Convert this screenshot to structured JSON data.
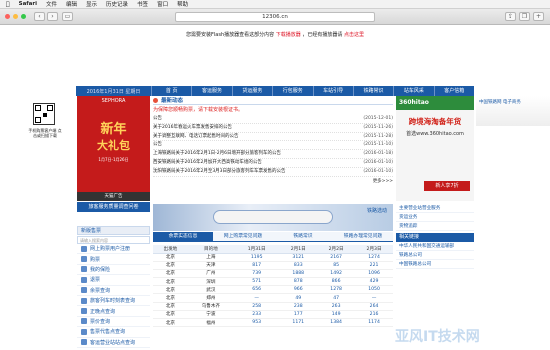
{
  "menubar": {
    "apple": "",
    "app": "Safari",
    "items": [
      "文件",
      "编辑",
      "显示",
      "历史记录",
      "书签",
      "窗口",
      "帮助"
    ]
  },
  "toolbar": {
    "url": "12306.cn",
    "back": "‹",
    "forward": "›"
  },
  "flash": {
    "text": "您需要安装Flash播放器查看这部分内容",
    "link": "下载播放器",
    "tail": "，已经有播放器请",
    "link2": "点击这里"
  },
  "nav": {
    "date": "2016年1月31日 星期日",
    "tabs": [
      "首 页",
      "客运服务",
      "货运服务",
      "行包服务",
      "车站引导",
      "铁路常识",
      "站车风采",
      "客户信箱"
    ]
  },
  "ad_left": {
    "qr_caption": "手机购票客户端 点击或扫描下载"
  },
  "sephora": {
    "brand": "SEPHORA",
    "line1": "新年",
    "line2": "大礼包",
    "line3": "1月7日-1月26日",
    "footer": "天猫广告"
  },
  "news": {
    "title": "最新动态",
    "notice": "为保障您顺畅购票，请下载安装根证书。",
    "notice_link": "根证书",
    "items": [
      {
        "t": "公告",
        "d": "(2015-12-01)"
      },
      {
        "t": "关于2016年春运火车票发售安排的公告",
        "d": "(2015-11-26)"
      },
      {
        "t": "关于调整互联网、电话订票起售时间的公告",
        "d": "(2015-11-28)"
      },
      {
        "t": "公告",
        "d": "(2015-11-10)"
      },
      {
        "t": "上海铁路局关于2016年2月1日-2月6日增开部分旅客列车的公告",
        "d": "(2016-01-18)"
      },
      {
        "t": "西安铁路局关于2016年2月加开大西高铁动车组的公告",
        "d": "(2016-01-10)"
      },
      {
        "t": "沈阳铁路局关于2016年2月至3月3日部分旅客列车车票发售的公告",
        "d": "(2016-01-10)"
      }
    ],
    "more": "更多>>>"
  },
  "hitao": {
    "brand": "360hitao",
    "line1": "跨境海淘备年货",
    "line2": "首选www.360hitao.com",
    "btn": "新人享7折"
  },
  "far_right": {
    "caption": "中国铁路网 电子商务"
  },
  "promo": {
    "label": "旅客服务质量调查问卷",
    "sub": "天猫广告"
  },
  "sidebar": {
    "header": "新版售票",
    "search_placeholder": "请输入搜索内容",
    "items": [
      "网上购票用户注册",
      "购票",
      "我的保险",
      "退票",
      "余票查询",
      "旅客列车时刻表查询",
      "正晚点查询",
      "票价查询",
      "售票代售点查询",
      "客运营业站站点查询"
    ]
  },
  "banner": {
    "label": "铁路选动",
    "sub": "中国铁路网络"
  },
  "table": {
    "tabs": [
      "余票实态信息",
      "网上购票常见问题",
      "铁路常识",
      "铁路办理常见问题"
    ],
    "headers": [
      "出发地",
      "目的地",
      "1月31日",
      "2月1日",
      "2月2日",
      "2月3日"
    ],
    "rows": [
      [
        "北京",
        "上海",
        "1195",
        "3121",
        "2167",
        "1274"
      ],
      [
        "北京",
        "天津",
        "817",
        "833",
        "85",
        "221"
      ],
      [
        "北京",
        "广州",
        "739",
        "1888",
        "1492",
        "1096"
      ],
      [
        "北京",
        "深圳",
        "571",
        "878",
        "866",
        "429"
      ],
      [
        "北京",
        "武汉",
        "656",
        "966",
        "1278",
        "1050"
      ],
      [
        "北京",
        "郑州",
        "—",
        "49",
        "47",
        "—"
      ],
      [
        "北京",
        "乌鲁木齐",
        "258",
        "238",
        "263",
        "264"
      ],
      [
        "北京",
        "宁波",
        "233",
        "177",
        "149",
        "216"
      ],
      [
        "北京",
        "福州",
        "953",
        "1171",
        "1384",
        "1174"
      ]
    ]
  },
  "right_col": {
    "items": [
      "主要营业站营业服务",
      "货运业务",
      "货物追踪"
    ],
    "header": "相关链接",
    "links": [
      "中华人民共和国交通运输部",
      "铁路总公司",
      "中国铁路总公司"
    ]
  },
  "watermark": "亚风IT技术网"
}
